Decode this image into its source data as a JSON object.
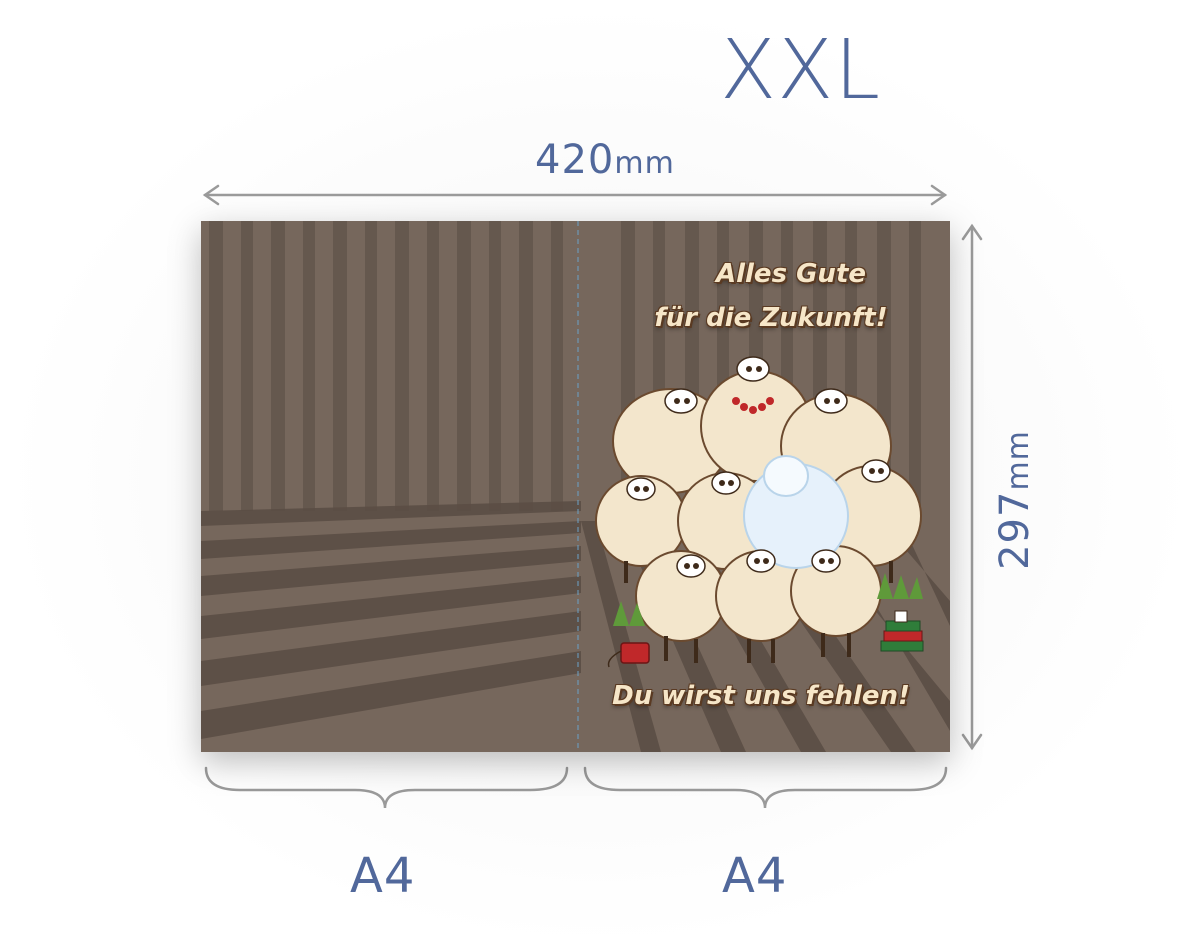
{
  "size_label": "XXL",
  "width": {
    "value": "420",
    "unit": "mm"
  },
  "height": {
    "value": "297",
    "unit": "mm"
  },
  "halves": {
    "left": "A4",
    "right": "A4"
  },
  "card": {
    "greeting_line1": "Alles Gute",
    "greeting_line2": "für die Zukunft!",
    "farewell": "Du wirst uns fehlen!"
  },
  "colors": {
    "label": "#51689b",
    "arrow": "#9a9a9a",
    "card_bg": "#76675c",
    "card_stripe_dark": "#5e5147",
    "greeting_text": "#f6e6c8",
    "fold_line": "#6aa2c8"
  }
}
